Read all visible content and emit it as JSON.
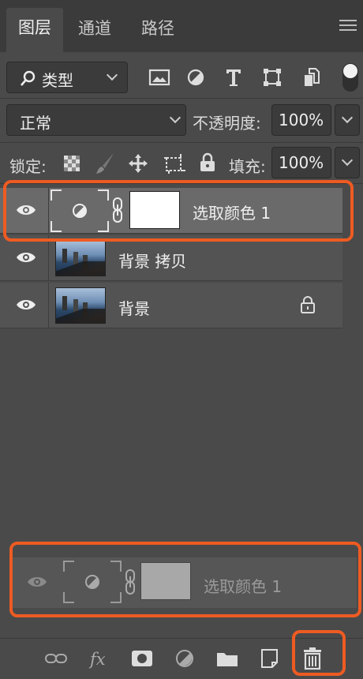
{
  "tabs": [
    {
      "label": "图层"
    },
    {
      "label": "通道"
    },
    {
      "label": "路径"
    }
  ],
  "filter": {
    "label": "类型"
  },
  "blend_mode": {
    "value": "正常"
  },
  "opacity": {
    "label": "不透明度:",
    "value": "100%"
  },
  "lock": {
    "label": "锁定:"
  },
  "fill": {
    "label": "填充:",
    "value": "100%"
  },
  "layers": [
    {
      "name": "选取颜色 1",
      "type": "adjustment",
      "selected": true
    },
    {
      "name": "背景 拷贝",
      "type": "image"
    },
    {
      "name": "背景",
      "type": "image",
      "locked": true
    }
  ],
  "drag_preview": {
    "name": "选取颜色 1"
  },
  "colors": {
    "highlight": "#ee5b22",
    "panel": "#4a4a4a",
    "selected_row": "#6a6a6a"
  }
}
